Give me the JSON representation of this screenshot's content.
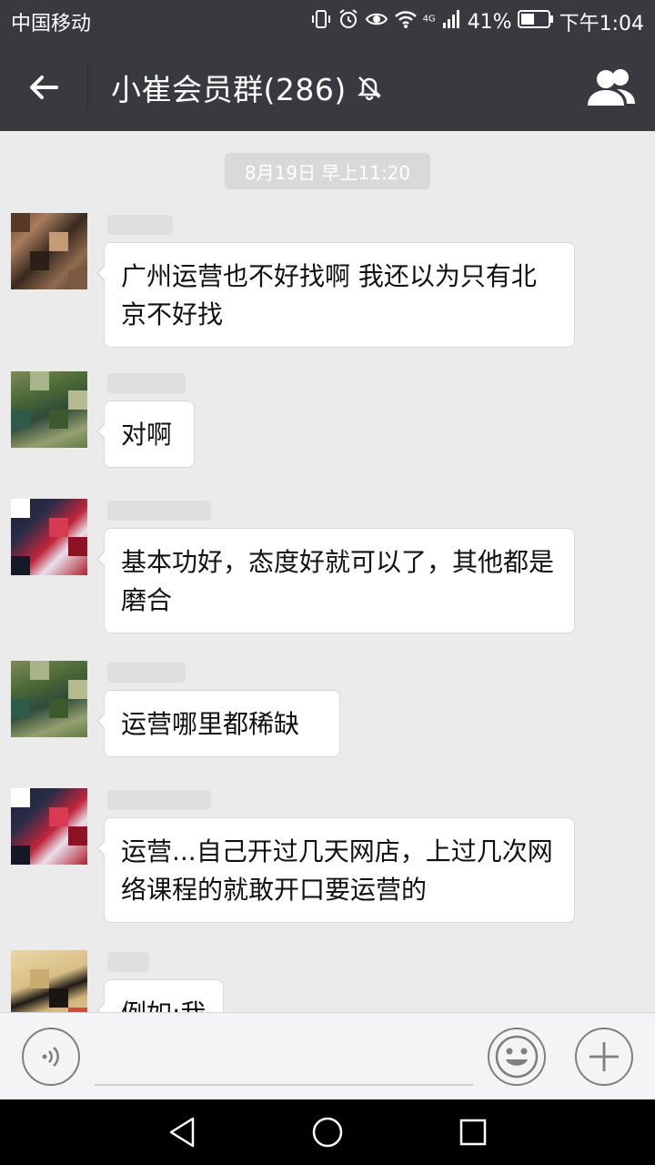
{
  "status_bar": {
    "carrier": "中国移动",
    "network": "4G",
    "battery": "41%",
    "time": "下午1:04"
  },
  "header": {
    "title": "小崔会员群(286)"
  },
  "chat": {
    "timestamp": "8月19日 早上11:20",
    "messages": [
      {
        "text": "广州运营也不好找啊 我还以为只有北京不好找"
      },
      {
        "text": "对啊"
      },
      {
        "text": "基本功好，态度好就可以了，其他都是磨合"
      },
      {
        "text": "运营哪里都稀缺"
      },
      {
        "text": "运营...自己开过几天网店，上过几次网络课程的就敢开口要运营的"
      },
      {
        "text": "例如:我"
      }
    ]
  },
  "input": {
    "placeholder": ""
  },
  "colors": {
    "header_bg": "#393a3f",
    "chat_bg": "#ebebeb",
    "bubble_bg": "#ffffff"
  }
}
